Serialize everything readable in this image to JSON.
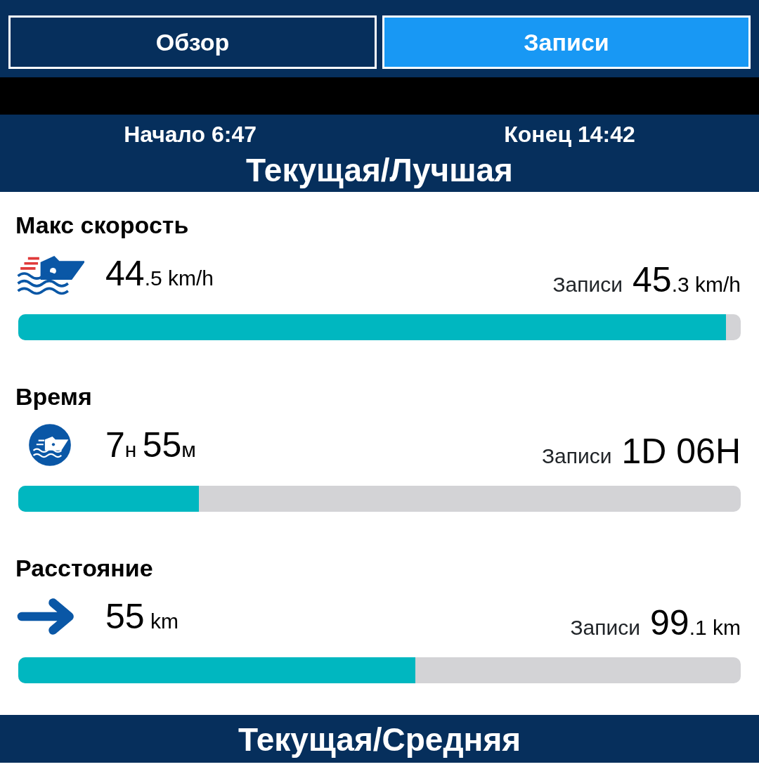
{
  "tabs": [
    {
      "label": "Обзор",
      "selected": false
    },
    {
      "label": "Записи",
      "selected": true
    }
  ],
  "session": {
    "start": "Начало 6:47",
    "end": "Конец 14:42"
  },
  "headings": [
    "Текущая/Лучшая",
    "Текущая/Средняя"
  ],
  "stats": [
    {
      "title": "Макс скорость",
      "kind": "boat",
      "reading": [
        {
          "text": "44",
          "kind": "big"
        },
        {
          "text": ".5 km/h",
          "kind": "small"
        }
      ],
      "record_label": "Записи",
      "record": [
        {
          "text": "45",
          "kind": "big"
        },
        {
          "text": ".3 km/h",
          "kind": "small"
        }
      ],
      "level": 0.98
    },
    {
      "title": "Время",
      "kind": "boat-circle",
      "reading": [
        {
          "text": "7",
          "kind": "big"
        },
        {
          "text": "н ",
          "kind": "small"
        },
        {
          "text": "55",
          "kind": "big"
        },
        {
          "text": "м",
          "kind": "small"
        }
      ],
      "record_label": "Записи",
      "record": [
        {
          "text": "1D 06H",
          "kind": "big"
        }
      ],
      "level": 0.25
    },
    {
      "title": "Расстояние",
      "kind": "arrow",
      "reading": [
        {
          "text": "55",
          "kind": "big"
        },
        {
          "text": " km",
          "kind": "small"
        }
      ],
      "record_label": "Записи",
      "record": [
        {
          "text": "99",
          "kind": "big"
        },
        {
          "text": ".1 km",
          "kind": "small"
        }
      ],
      "level": 0.55
    }
  ]
}
